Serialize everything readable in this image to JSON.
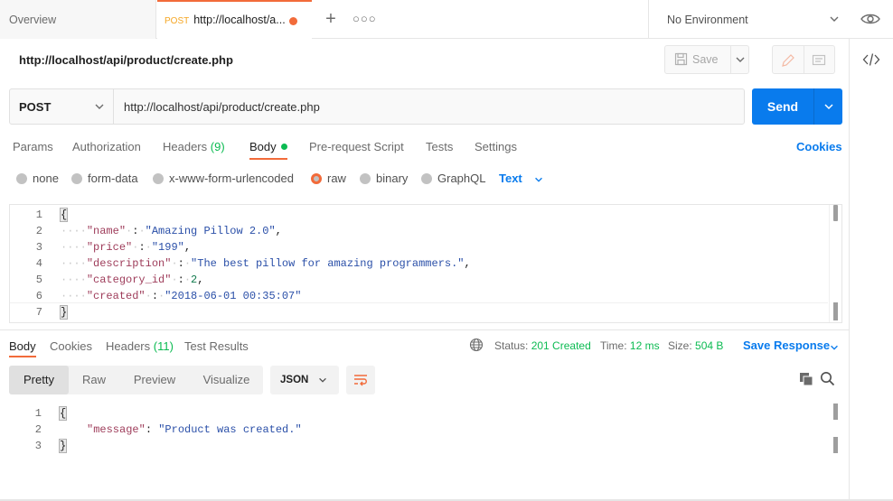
{
  "tabs": {
    "overview": "Overview",
    "active_method": "POST",
    "active_title": "http://localhost/a...",
    "environment": "No Environment"
  },
  "request": {
    "title": "http://localhost/api/product/create.php",
    "save_label": "Save",
    "method": "POST",
    "url": "http://localhost/api/product/create.php",
    "send_label": "Send"
  },
  "request_tabs": [
    {
      "label": "Params"
    },
    {
      "label": "Authorization"
    },
    {
      "label": "Headers",
      "count": "(9)"
    },
    {
      "label": "Body"
    },
    {
      "label": "Pre-request Script"
    },
    {
      "label": "Tests"
    },
    {
      "label": "Settings"
    }
  ],
  "cookies_label": "Cookies",
  "body_types": [
    "none",
    "form-data",
    "x-www-form-urlencoded",
    "raw",
    "binary",
    "GraphQL"
  ],
  "body_format": "Text",
  "request_body": {
    "line_numbers": [
      "1",
      "2",
      "3",
      "4",
      "5",
      "6",
      "7"
    ],
    "open": "{",
    "close": "}",
    "fields": [
      {
        "key": "\"name\"",
        "value": "\"Amazing Pillow 2.0\"",
        "comma": ","
      },
      {
        "key": "\"price\"",
        "value": "\"199\"",
        "comma": ","
      },
      {
        "key": "\"description\"",
        "value": "\"The best pillow for amazing programmers.\"",
        "comma": ","
      },
      {
        "key": "\"category_id\"",
        "value": "2",
        "comma": ","
      },
      {
        "key": "\"created\"",
        "value": "\"2018-06-01 00:35:07\"",
        "comma": ""
      }
    ]
  },
  "response_tabs": [
    {
      "label": "Body"
    },
    {
      "label": "Cookies"
    },
    {
      "label": "Headers",
      "count": "(11)"
    },
    {
      "label": "Test Results"
    }
  ],
  "response_meta": {
    "status_label": "Status:",
    "status_value": "201 Created",
    "time_label": "Time:",
    "time_value": "12 ms",
    "size_label": "Size:",
    "size_value": "504 B",
    "save_response": "Save Response"
  },
  "view_modes": [
    "Pretty",
    "Raw",
    "Preview",
    "Visualize"
  ],
  "response_format": "JSON",
  "response_body": {
    "line_numbers": [
      "1",
      "2",
      "3"
    ],
    "open": "{",
    "key": "\"message\"",
    "value": "\"Product was created.\"",
    "close": "}"
  },
  "colors": {
    "accent": "#f26b3a",
    "primary": "#097bed",
    "success": "#0cbb52"
  }
}
